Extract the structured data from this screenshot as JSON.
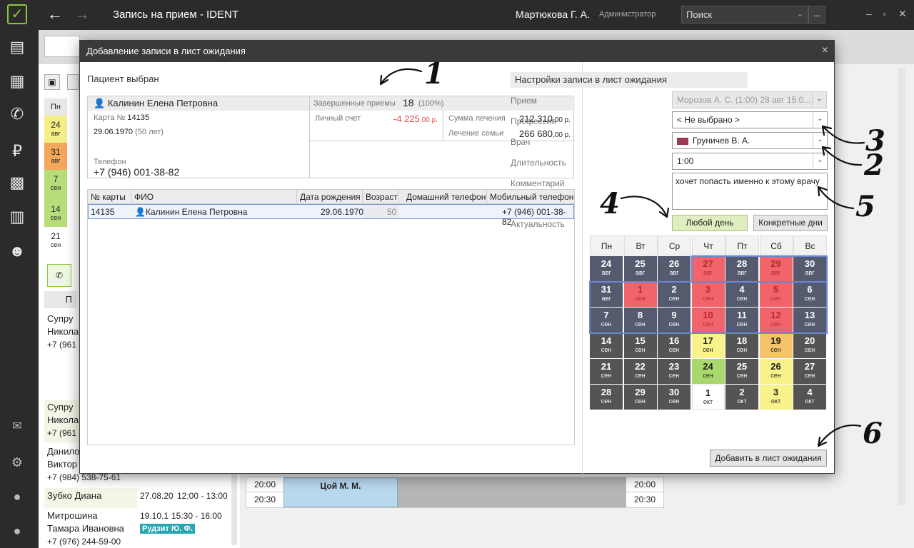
{
  "app": {
    "title": "Запись на прием  - IDENT",
    "user": "Мартюкова Г. А.",
    "role": "Администратор",
    "search_placeholder": "Поиск",
    "more": "..."
  },
  "background": {
    "days": [
      {
        "day": "Пн",
        "date": "",
        "month": ""
      },
      {
        "day": "",
        "date": "24",
        "month": "авг"
      },
      {
        "day": "",
        "date": "31",
        "month": "авг"
      },
      {
        "day": "",
        "date": "7",
        "month": "сен"
      },
      {
        "day": "",
        "date": "14",
        "month": "сен"
      },
      {
        "day": "",
        "date": "21",
        "month": "сен"
      }
    ],
    "patients_header": "П",
    "patients": [
      {
        "name": "Супру",
        "name2": "Никола",
        "phone": "+7 (961"
      },
      {
        "name": "Супру",
        "name2": "Никола",
        "phone": "+7 (961"
      },
      {
        "name": "Данило",
        "name2": "Виктор",
        "phone": "+7 (984) 538-75-61"
      },
      {
        "name": "Зубко Диана",
        "name2": "",
        "phone": ""
      },
      {
        "name": "Митрошина",
        "name2": "Тамара Ивановна",
        "phone": "+7 (976) 244-59-00"
      }
    ],
    "appt1": {
      "date": "27.08.20",
      "time": "12:00 - 13:00"
    },
    "appt2": {
      "date": "19.10.1",
      "time": "15:30 - 16:00",
      "doctor": "Рудзит Ю. Ф."
    },
    "sched": {
      "t1": "20:00",
      "t2": "20:30",
      "doctor": "Цой М. М."
    }
  },
  "modal": {
    "title": "Добавление записи в лист ожидания",
    "close": "×",
    "patient_section": "Пациент выбран",
    "patient": {
      "name": "Калинин Елена Петровна",
      "card_label": "Карта №",
      "card": "14135",
      "dob": "29.06.1970",
      "age": "(50 лет)",
      "phone_label": "Телефон",
      "phone": "+7 (946) 001-38-82",
      "completed_label": "Завершенные приемы",
      "completed": "18",
      "completed_pct": "(100%)",
      "account_label": "Личный счет",
      "account": "-4 225",
      "account_kop": ",00 р.",
      "treat_label": "Сумма лечения",
      "treat": "212 310",
      "treat_kop": ",00 р.",
      "family_label": "Лечение семьи",
      "family": "266 680",
      "family_kop": ",00 р."
    },
    "table": {
      "headers": [
        "№ карты",
        "ФИО",
        "Дата рождения",
        "Возраст",
        "Домашний телефон",
        "Мобильный телефон"
      ],
      "row": {
        "card": "14135",
        "name": "Калинин Елена Петровна",
        "dob": "29.06.1970",
        "age": "50",
        "home": "",
        "mobile": "+7 (946) 001-38-82"
      }
    },
    "settings": {
      "title": "Настройки записи в лист ожидания",
      "appt_label": "Прием",
      "appt_value": "Морозов А. С. (1:00) 28 авг 15:0...",
      "prof_label": "Профессия",
      "prof_value": "< Не выбрано >",
      "doctor_label": "Врач",
      "doctor_value": "Груничев В. А.",
      "doctor_color": "#9b3a55",
      "duration_label": "Длительность",
      "duration_value": "1:00",
      "comment_label": "Комментарий",
      "comment_value": "хочет попасть именно к этому врачу",
      "actual_label": "Актуальность",
      "btn_any": "Любой день",
      "btn_specific": "Конкретные дни",
      "add_button": "Добавить в лист ожидания"
    },
    "calendar": {
      "weekdays": [
        "Пн",
        "Вт",
        "Ср",
        "Чт",
        "Пт",
        "Сб",
        "Вс"
      ],
      "colors": {
        "dark": "#545454",
        "selected": "#555b6e",
        "red": "#f0646c",
        "yellow": "#f7f28a",
        "orange": "#f5c36b",
        "green": "#a9d86e",
        "white": "#ffffff"
      },
      "weeks": [
        [
          {
            "d": "24",
            "m": "авг",
            "c": "selected"
          },
          {
            "d": "25",
            "m": "авг",
            "c": "selected"
          },
          {
            "d": "26",
            "m": "авг",
            "c": "selected"
          },
          {
            "d": "27",
            "m": "авг",
            "c": "red"
          },
          {
            "d": "28",
            "m": "авг",
            "c": "selected"
          },
          {
            "d": "29",
            "m": "авг",
            "c": "red"
          },
          {
            "d": "30",
            "m": "авг",
            "c": "selected"
          }
        ],
        [
          {
            "d": "31",
            "m": "авг",
            "c": "selected"
          },
          {
            "d": "1",
            "m": "сен",
            "c": "red"
          },
          {
            "d": "2",
            "m": "сен",
            "c": "selected"
          },
          {
            "d": "3",
            "m": "сен",
            "c": "red"
          },
          {
            "d": "4",
            "m": "сен",
            "c": "selected"
          },
          {
            "d": "5",
            "m": "сен",
            "c": "red"
          },
          {
            "d": "6",
            "m": "сен",
            "c": "selected"
          }
        ],
        [
          {
            "d": "7",
            "m": "сен",
            "c": "selected"
          },
          {
            "d": "8",
            "m": "сен",
            "c": "selected"
          },
          {
            "d": "9",
            "m": "сен",
            "c": "selected"
          },
          {
            "d": "10",
            "m": "сен",
            "c": "red"
          },
          {
            "d": "11",
            "m": "сен",
            "c": "selected"
          },
          {
            "d": "12",
            "m": "сен",
            "c": "red"
          },
          {
            "d": "13",
            "m": "сен",
            "c": "selected"
          }
        ],
        [
          {
            "d": "14",
            "m": "сен",
            "c": "dark"
          },
          {
            "d": "15",
            "m": "сен",
            "c": "dark"
          },
          {
            "d": "16",
            "m": "сен",
            "c": "dark"
          },
          {
            "d": "17",
            "m": "сен",
            "c": "yellow"
          },
          {
            "d": "18",
            "m": "сен",
            "c": "dark"
          },
          {
            "d": "19",
            "m": "сен",
            "c": "orange"
          },
          {
            "d": "20",
            "m": "сен",
            "c": "dark"
          }
        ],
        [
          {
            "d": "21",
            "m": "сен",
            "c": "dark"
          },
          {
            "d": "22",
            "m": "сен",
            "c": "dark"
          },
          {
            "d": "23",
            "m": "сен",
            "c": "dark"
          },
          {
            "d": "24",
            "m": "сен",
            "c": "green"
          },
          {
            "d": "25",
            "m": "сен",
            "c": "dark"
          },
          {
            "d": "26",
            "m": "сен",
            "c": "yellow"
          },
          {
            "d": "27",
            "m": "сен",
            "c": "dark"
          }
        ],
        [
          {
            "d": "28",
            "m": "сен",
            "c": "dark"
          },
          {
            "d": "29",
            "m": "сен",
            "c": "dark"
          },
          {
            "d": "30",
            "m": "сен",
            "c": "dark"
          },
          {
            "d": "1",
            "m": "окт",
            "c": "white"
          },
          {
            "d": "2",
            "m": "окт",
            "c": "dark"
          },
          {
            "d": "3",
            "m": "окт",
            "c": "yellow"
          },
          {
            "d": "4",
            "m": "окт",
            "c": "dark"
          }
        ]
      ]
    }
  },
  "annotations": [
    "1",
    "2",
    "3",
    "4",
    "5",
    "6"
  ]
}
